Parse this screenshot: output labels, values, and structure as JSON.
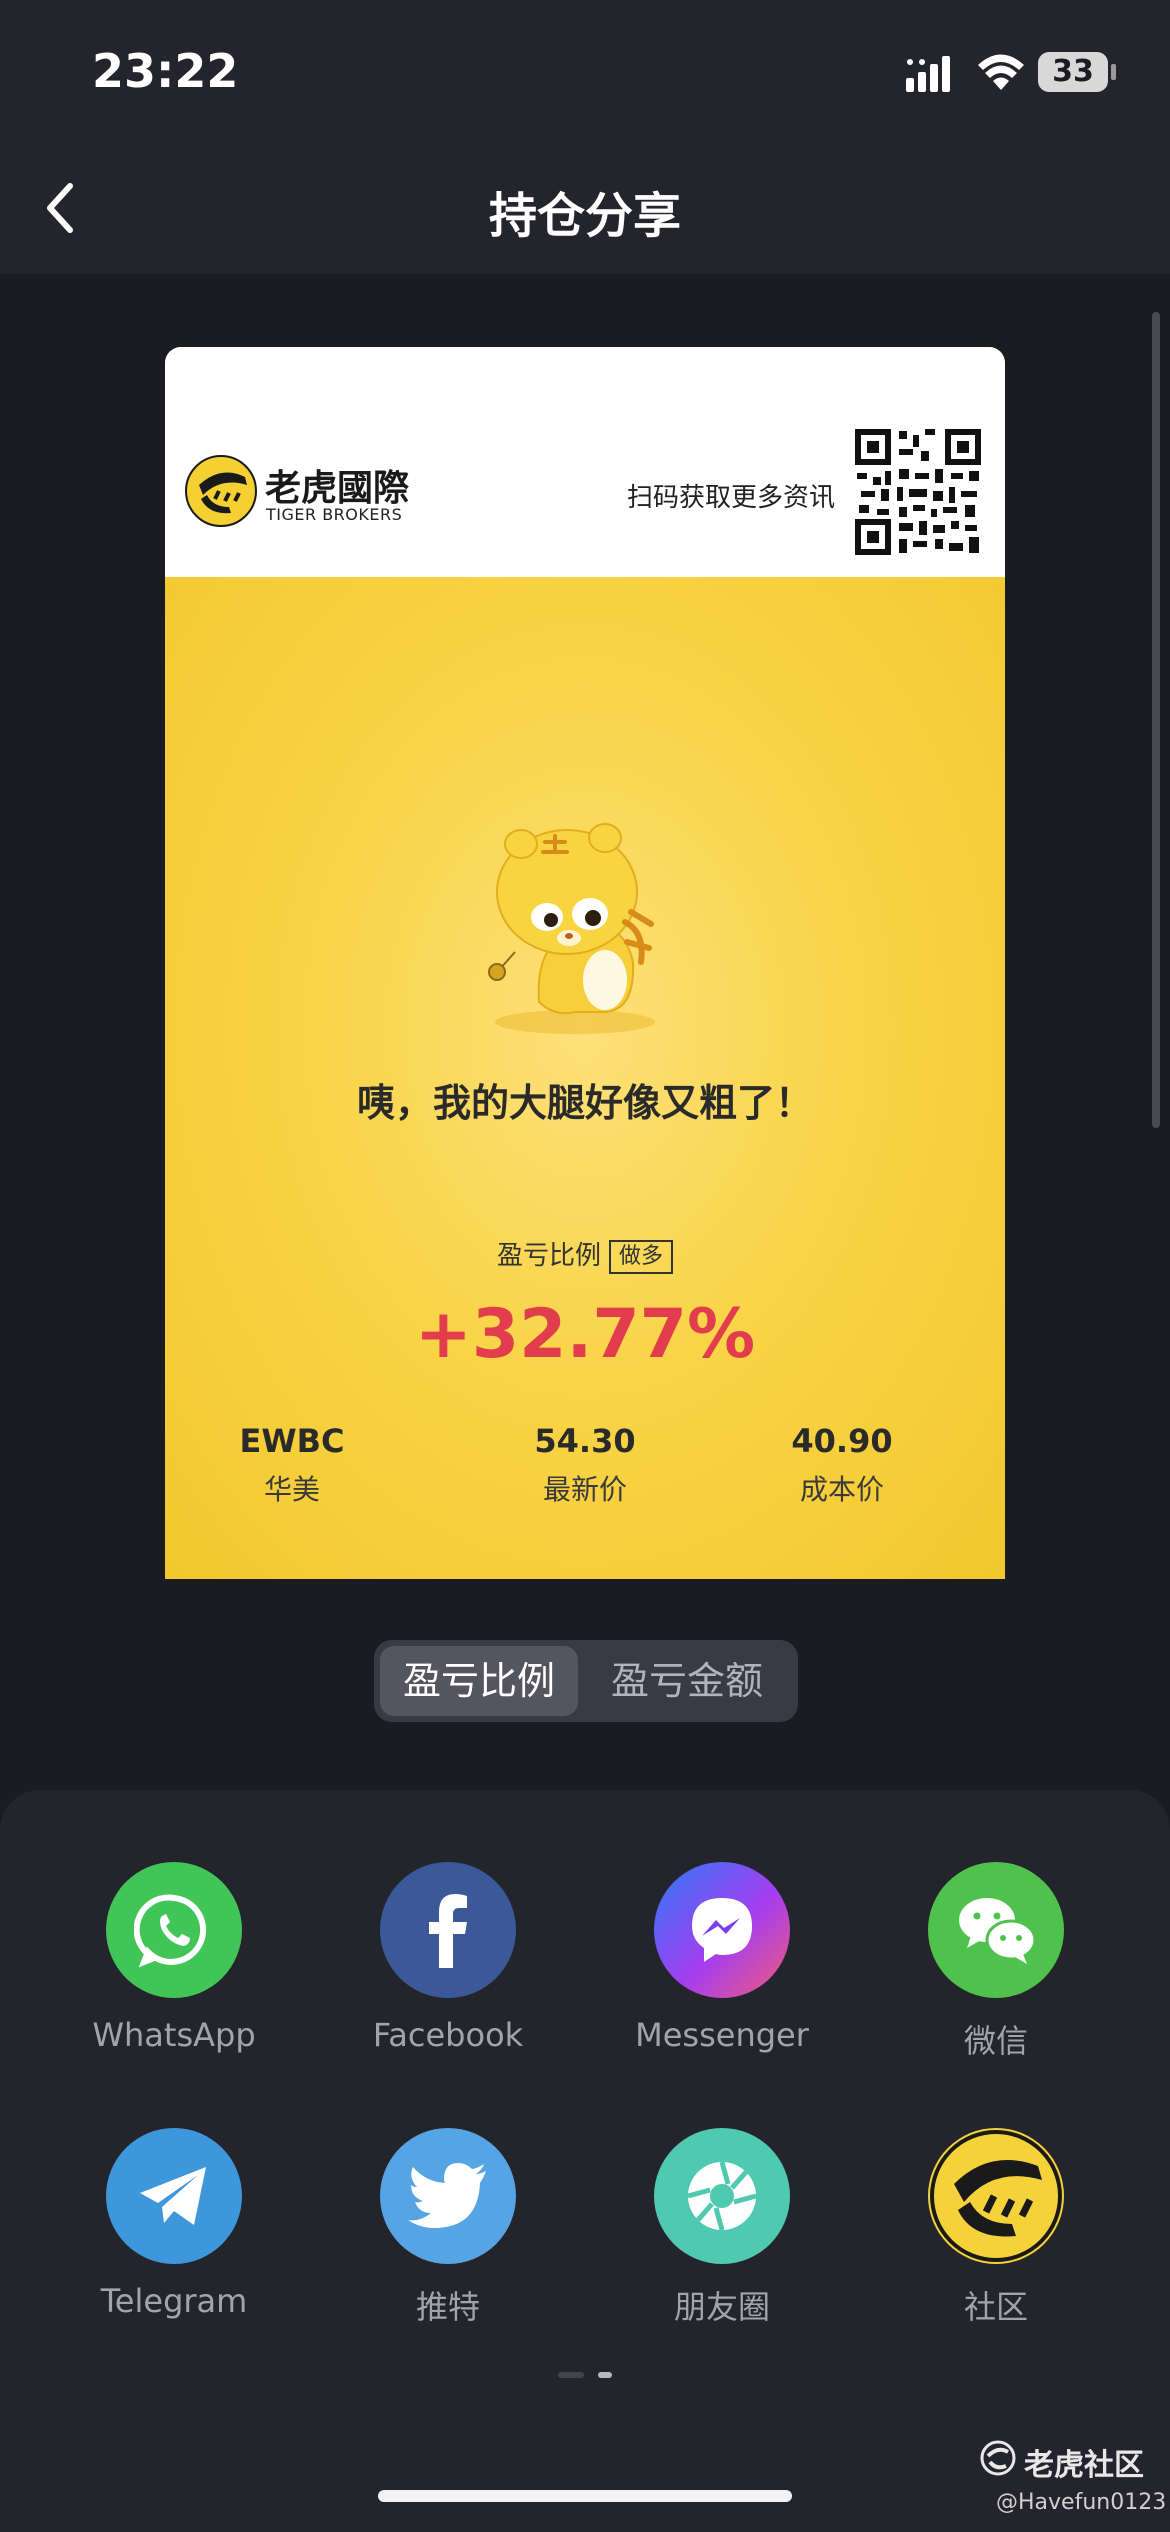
{
  "status_bar": {
    "time": "23:22",
    "battery": "33"
  },
  "nav": {
    "title": "持仓分享"
  },
  "card": {
    "brand_cn": "老虎國際",
    "brand_en": "TIGER BROKERS",
    "scan_text": "扫码获取更多资讯",
    "slogan": "咦，我的大腿好像又粗了！",
    "ratio_label": "盈亏比例",
    "position_tag": "做多",
    "pnl_percent": "+32.77%",
    "stats": [
      {
        "value": "EWBC",
        "label": "华美"
      },
      {
        "value": "54.30",
        "label": "最新价"
      },
      {
        "value": "40.90",
        "label": "成本价"
      }
    ]
  },
  "toggle": {
    "options": [
      "盈亏比例",
      "盈亏金额"
    ],
    "selected": "盈亏比例"
  },
  "share": {
    "row1": [
      {
        "label": "WhatsApp",
        "icon": "whatsapp-icon",
        "color": "#41c557"
      },
      {
        "label": "Facebook",
        "icon": "facebook-icon",
        "color": "#3b5998"
      },
      {
        "label": "Messenger",
        "icon": "messenger-icon",
        "color": "#8a3cf0"
      },
      {
        "label": "微信",
        "icon": "wechat-icon",
        "color": "#4fc24d"
      }
    ],
    "row2": [
      {
        "label": "Telegram",
        "icon": "telegram-icon",
        "color": "#3f97db"
      },
      {
        "label": "推特",
        "icon": "twitter-icon",
        "color": "#55a4e3"
      },
      {
        "label": "朋友圈",
        "icon": "moments-icon",
        "color": "#4fc9b0"
      },
      {
        "label": "社区",
        "icon": "tiger-community-icon",
        "color": "#f6d23a"
      }
    ]
  },
  "watermark": {
    "brand": "老虎社区",
    "user": "@Havefun0123"
  },
  "colors": {
    "background": "#1b1b22",
    "card": "#f5cf3b",
    "positive": "#e23d4d"
  }
}
